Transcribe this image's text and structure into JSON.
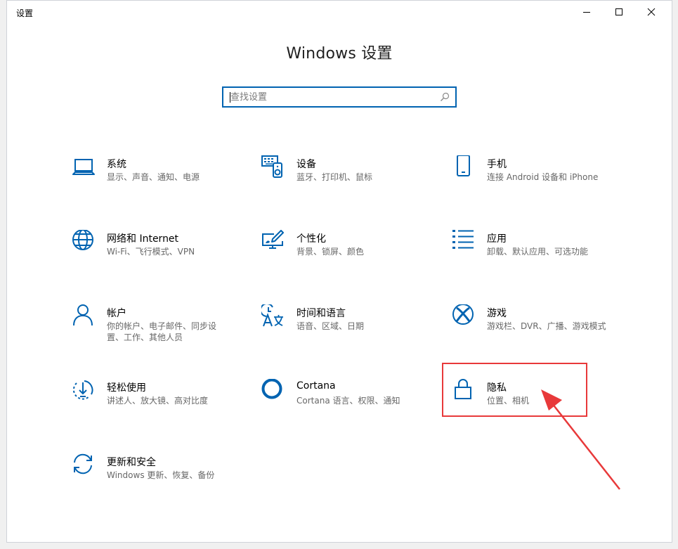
{
  "window": {
    "title": "设置",
    "controls": {
      "minimize_icon": "minimize-icon",
      "maximize_icon": "maximize-icon",
      "close_icon": "close-icon"
    }
  },
  "page_title": "Windows 设置",
  "search": {
    "placeholder": "查找设置",
    "value": "",
    "icon": "search-icon"
  },
  "tiles": [
    {
      "id": "system",
      "label": "系统",
      "desc": "显示、声音、通知、电源",
      "icon": "laptop-icon"
    },
    {
      "id": "devices",
      "label": "设备",
      "desc": "蓝牙、打印机、鼠标",
      "icon": "devices-icon"
    },
    {
      "id": "phone",
      "label": "手机",
      "desc": "连接 Android 设备和 iPhone",
      "icon": "phone-icon"
    },
    {
      "id": "network",
      "label": "网络和 Internet",
      "desc": "Wi-Fi、飞行模式、VPN",
      "icon": "globe-icon"
    },
    {
      "id": "personalization",
      "label": "个性化",
      "desc": "背景、锁屏、颜色",
      "icon": "paint-monitor-icon"
    },
    {
      "id": "apps",
      "label": "应用",
      "desc": "卸载、默认应用、可选功能",
      "icon": "apps-list-icon"
    },
    {
      "id": "accounts",
      "label": "帐户",
      "desc": "你的帐户、电子邮件、同步设置、工作、其他人员",
      "icon": "person-icon"
    },
    {
      "id": "time-language",
      "label": "时间和语言",
      "desc": "语音、区域、日期",
      "icon": "time-language-icon"
    },
    {
      "id": "gaming",
      "label": "游戏",
      "desc": "游戏栏、DVR、广播、游戏模式",
      "icon": "xbox-icon"
    },
    {
      "id": "ease-of-access",
      "label": "轻松使用",
      "desc": "讲述人、放大镜、高对比度",
      "icon": "ease-of-access-icon"
    },
    {
      "id": "cortana",
      "label": "Cortana",
      "desc": "Cortana 语言、权限、通知",
      "icon": "cortana-icon"
    },
    {
      "id": "privacy",
      "label": "隐私",
      "desc": "位置、相机",
      "icon": "lock-icon"
    },
    {
      "id": "update-security",
      "label": "更新和安全",
      "desc": "Windows 更新、恢复、备份",
      "icon": "sync-icon"
    }
  ],
  "annotation": {
    "highlight_color": "#e8393a",
    "target": "privacy"
  },
  "colors": {
    "accent": "#0063b1",
    "icon": "#0063b1",
    "desc_text": "#676767"
  }
}
